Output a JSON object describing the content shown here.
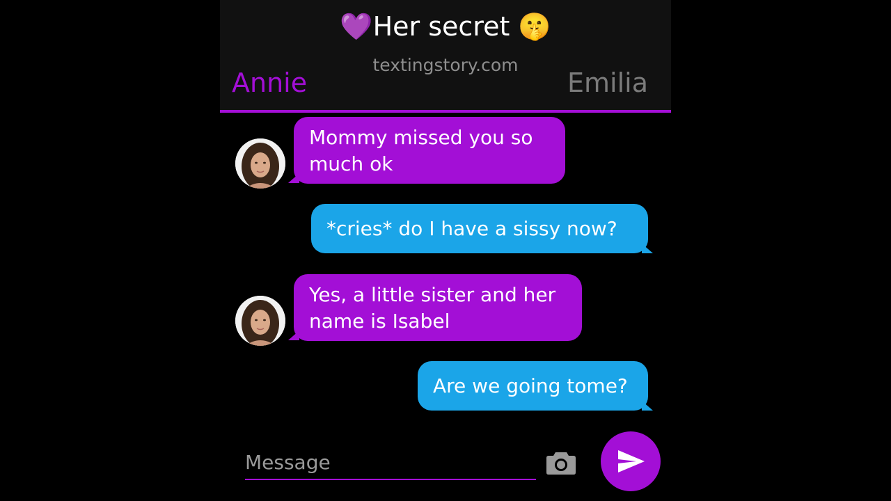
{
  "header": {
    "title": "💜Her secret 🤫",
    "watermark": "textingstory.com",
    "left_name": "Annie",
    "right_name": "Emilia"
  },
  "messages": [
    {
      "side": "left",
      "text": "Mommy missed you so much ok"
    },
    {
      "side": "right",
      "text": "*cries* do I have a sissy now?"
    },
    {
      "side": "left",
      "text": "Yes, a little sister and her name is Isabel"
    },
    {
      "side": "right",
      "text": "Are we going tome?"
    }
  ],
  "composer": {
    "placeholder": "Message",
    "camera_icon": "camera-icon",
    "send_icon": "send-icon"
  },
  "colors": {
    "accent": "#a30fd6",
    "outgoing": "#1ba5e8",
    "background": "#000000",
    "header": "#111111"
  }
}
